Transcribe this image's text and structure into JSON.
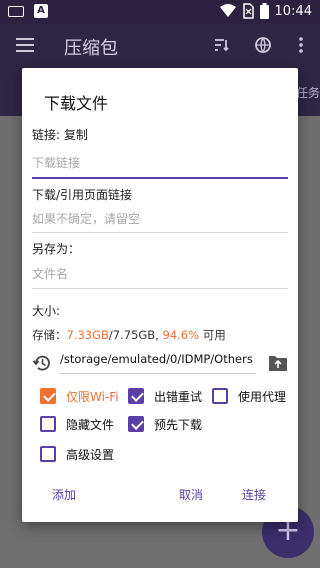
{
  "status_bar": {
    "time": "10:44"
  },
  "app_bar": {
    "title": "压缩包",
    "tab_partial": "任务"
  },
  "dialog": {
    "title": "下载文件",
    "link": {
      "label": "链接:",
      "paste": "复制",
      "placeholder": "下载链接"
    },
    "referer": {
      "label": "下载/引用页面链接",
      "placeholder": "如果不确定，请留空"
    },
    "save_as": {
      "label": "另存为：",
      "placeholder": "文件名"
    },
    "size": {
      "label": "大小:"
    },
    "storage": {
      "prefix": "存储：",
      "used": "7.33GB",
      "total": "/7.75GB, ",
      "percent": "94.6%",
      "suffix": " 可用"
    },
    "path": "/storage/emulated/0/IDMP/Others",
    "options": {
      "wifi_only": {
        "label": "仅限Wi-Fi",
        "checked": true
      },
      "retry_on_error": {
        "label": "出错重试",
        "checked": true
      },
      "use_proxy": {
        "label": "使用代理",
        "checked": false
      },
      "hidden_file": {
        "label": "隐藏文件",
        "checked": false
      },
      "pre_download": {
        "label": "预先下载",
        "checked": true
      },
      "advanced": {
        "label": "高级设置",
        "checked": false
      }
    },
    "buttons": {
      "add": "添加",
      "cancel": "取消",
      "connect": "连接"
    }
  },
  "fab": {
    "icon": "plus-icon"
  },
  "colors": {
    "accent": "#5b3fa6",
    "warning": "#f0702d"
  }
}
